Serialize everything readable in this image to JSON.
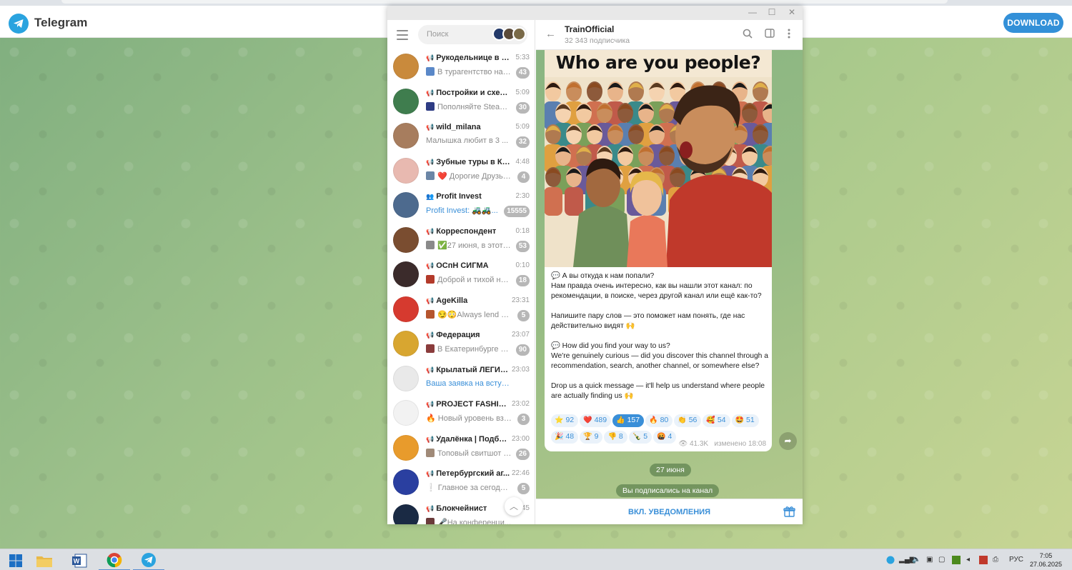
{
  "header": {
    "brand": "Telegram",
    "download_label": "DOWNLOAD"
  },
  "left": {
    "search_placeholder": "Поиск",
    "chats": [
      {
        "name": "Рукодельнице в по...",
        "time": "5:33",
        "preview": "В турагентство на уд...",
        "badge": "43",
        "channel": true,
        "avatar_color": "#c98a3c",
        "thumb_color": "#5a88c8",
        "preview_blue": false
      },
      {
        "name": "Постройки и схемы...",
        "time": "5:09",
        "preview": "Пополняйте Steam ...",
        "badge": "30",
        "channel": true,
        "avatar_color": "#3f7d4e",
        "thumb_color": "#2e3c84",
        "preview_blue": false
      },
      {
        "name": "wild_milana",
        "time": "5:09",
        "preview": "Малышка любит  в 3 ...",
        "badge": "32",
        "channel": true,
        "avatar_color": "#a77d5e",
        "thumb_color": "",
        "preview_blue": false
      },
      {
        "name": "Зубные туры в Кит...",
        "time": "4:48",
        "preview": "❤️ Дорогие Друзья, ...",
        "badge": "4",
        "channel": true,
        "avatar_color": "#e8b9b0",
        "thumb_color": "#6b86a6",
        "preview_blue": false
      },
      {
        "name": "Profit Invest",
        "time": "2:30",
        "preview": "Profit Invest: 🚜🚜...",
        "badge": "15555",
        "channel": false,
        "avatar_color": "#4d6a8e",
        "thumb_color": "",
        "preview_blue": true
      },
      {
        "name": "Корреспондент",
        "time": "0:18",
        "preview": "✅27 июня, в этот д...",
        "badge": "53",
        "channel": true,
        "avatar_color": "#7a4d30",
        "thumb_color": "#8a8a8a",
        "preview_blue": false
      },
      {
        "name": "ОСпН СИГМА",
        "time": "0:10",
        "preview": "Доброй и тихой ноч...",
        "badge": "18",
        "channel": true,
        "avatar_color": "#3b2b2b",
        "thumb_color": "#b33a2a",
        "preview_blue": false
      },
      {
        "name": "AgeKilla",
        "time": "23:31",
        "preview": "😏😳Always lend a h...",
        "badge": "5",
        "channel": true,
        "avatar_color": "#d63a2f",
        "thumb_color": "#b5552e",
        "preview_blue": false
      },
      {
        "name": "Федерация",
        "time": "23:07",
        "preview": "В Екатеринбурге сос...",
        "badge": "90",
        "channel": true,
        "avatar_color": "#d8a630",
        "thumb_color": "#8a3c3c",
        "preview_blue": false
      },
      {
        "name": "Крылатый ЛЕГИОН",
        "time": "23:03",
        "preview": "Ваша заявка на вступление ...",
        "badge": "",
        "channel": true,
        "avatar_color": "#e9e9e9",
        "thumb_color": "",
        "preview_blue": true
      },
      {
        "name": "PROJECT FASHION",
        "time": "23:02",
        "preview": "🔥 Новый уровень взаи...",
        "badge": "3",
        "channel": true,
        "avatar_color": "#f2f2f2",
        "thumb_color": "",
        "preview_blue": false
      },
      {
        "name": "Удалёнка | Подбо...",
        "time": "23:00",
        "preview": "Топовый свитшот Ni...",
        "badge": "26",
        "channel": true,
        "avatar_color": "#e89b2c",
        "thumb_color": "#a08a78",
        "preview_blue": false
      },
      {
        "name": "Петербургский аг...",
        "time": "22:46",
        "preview": "❕ Главное за сегодня в ...",
        "badge": "5",
        "channel": true,
        "avatar_color": "#2a3fa0",
        "thumb_color": "",
        "preview_blue": false
      },
      {
        "name": "Блокчейнист",
        "time": "45",
        "preview": "🎤На конференци...",
        "badge": "",
        "channel": true,
        "avatar_color": "#1a2a44",
        "thumb_color": "#6a3a3a",
        "preview_blue": false
      }
    ]
  },
  "chat": {
    "title": "TrainOfficial",
    "subtitle": "32 343 подписчика",
    "poster_title": "Who are you people?",
    "message": [
      "💬 А вы откуда к нам попали?\nНам правда очень интересно, как вы нашли этот канал: по рекомендации, в поиске, через другой канал или ещё как-то?",
      "Напишите пару слов — это поможет нам понять, где нас действительно видят 🙌",
      "💬 How did you find your way to us?\nWe're genuinely curious — did you discover this channel through a recommendation, search, another channel, or somewhere else?",
      "Drop us a quick message — it'll help us understand where people are actually finding us 🙌"
    ],
    "reactions": [
      {
        "emoji": "⭐",
        "count": "92",
        "active": false
      },
      {
        "emoji": "❤️",
        "count": "489",
        "active": false
      },
      {
        "emoji": "👍",
        "count": "157",
        "active": true
      },
      {
        "emoji": "🔥",
        "count": "80",
        "active": false
      },
      {
        "emoji": "👏",
        "count": "56",
        "active": false
      },
      {
        "emoji": "🥰",
        "count": "54",
        "active": false
      },
      {
        "emoji": "🤩",
        "count": "51",
        "active": false
      },
      {
        "emoji": "🎉",
        "count": "48",
        "active": false
      },
      {
        "emoji": "🏆",
        "count": "9",
        "active": false
      },
      {
        "emoji": "👎",
        "count": "8",
        "active": false
      },
      {
        "emoji": "🍾",
        "count": "5",
        "active": false
      },
      {
        "emoji": "🤬",
        "count": "4",
        "active": false
      }
    ],
    "views": "41.3K",
    "edited": "изменено 18:08",
    "date_pill": "27 июня",
    "service_pill": "Вы подписались на канал",
    "notify_label": "ВКЛ. УВЕДОМЛЕНИЯ"
  },
  "taskbar": {
    "lang": "РУС",
    "time": "7:05",
    "date": "27.06.2025"
  }
}
